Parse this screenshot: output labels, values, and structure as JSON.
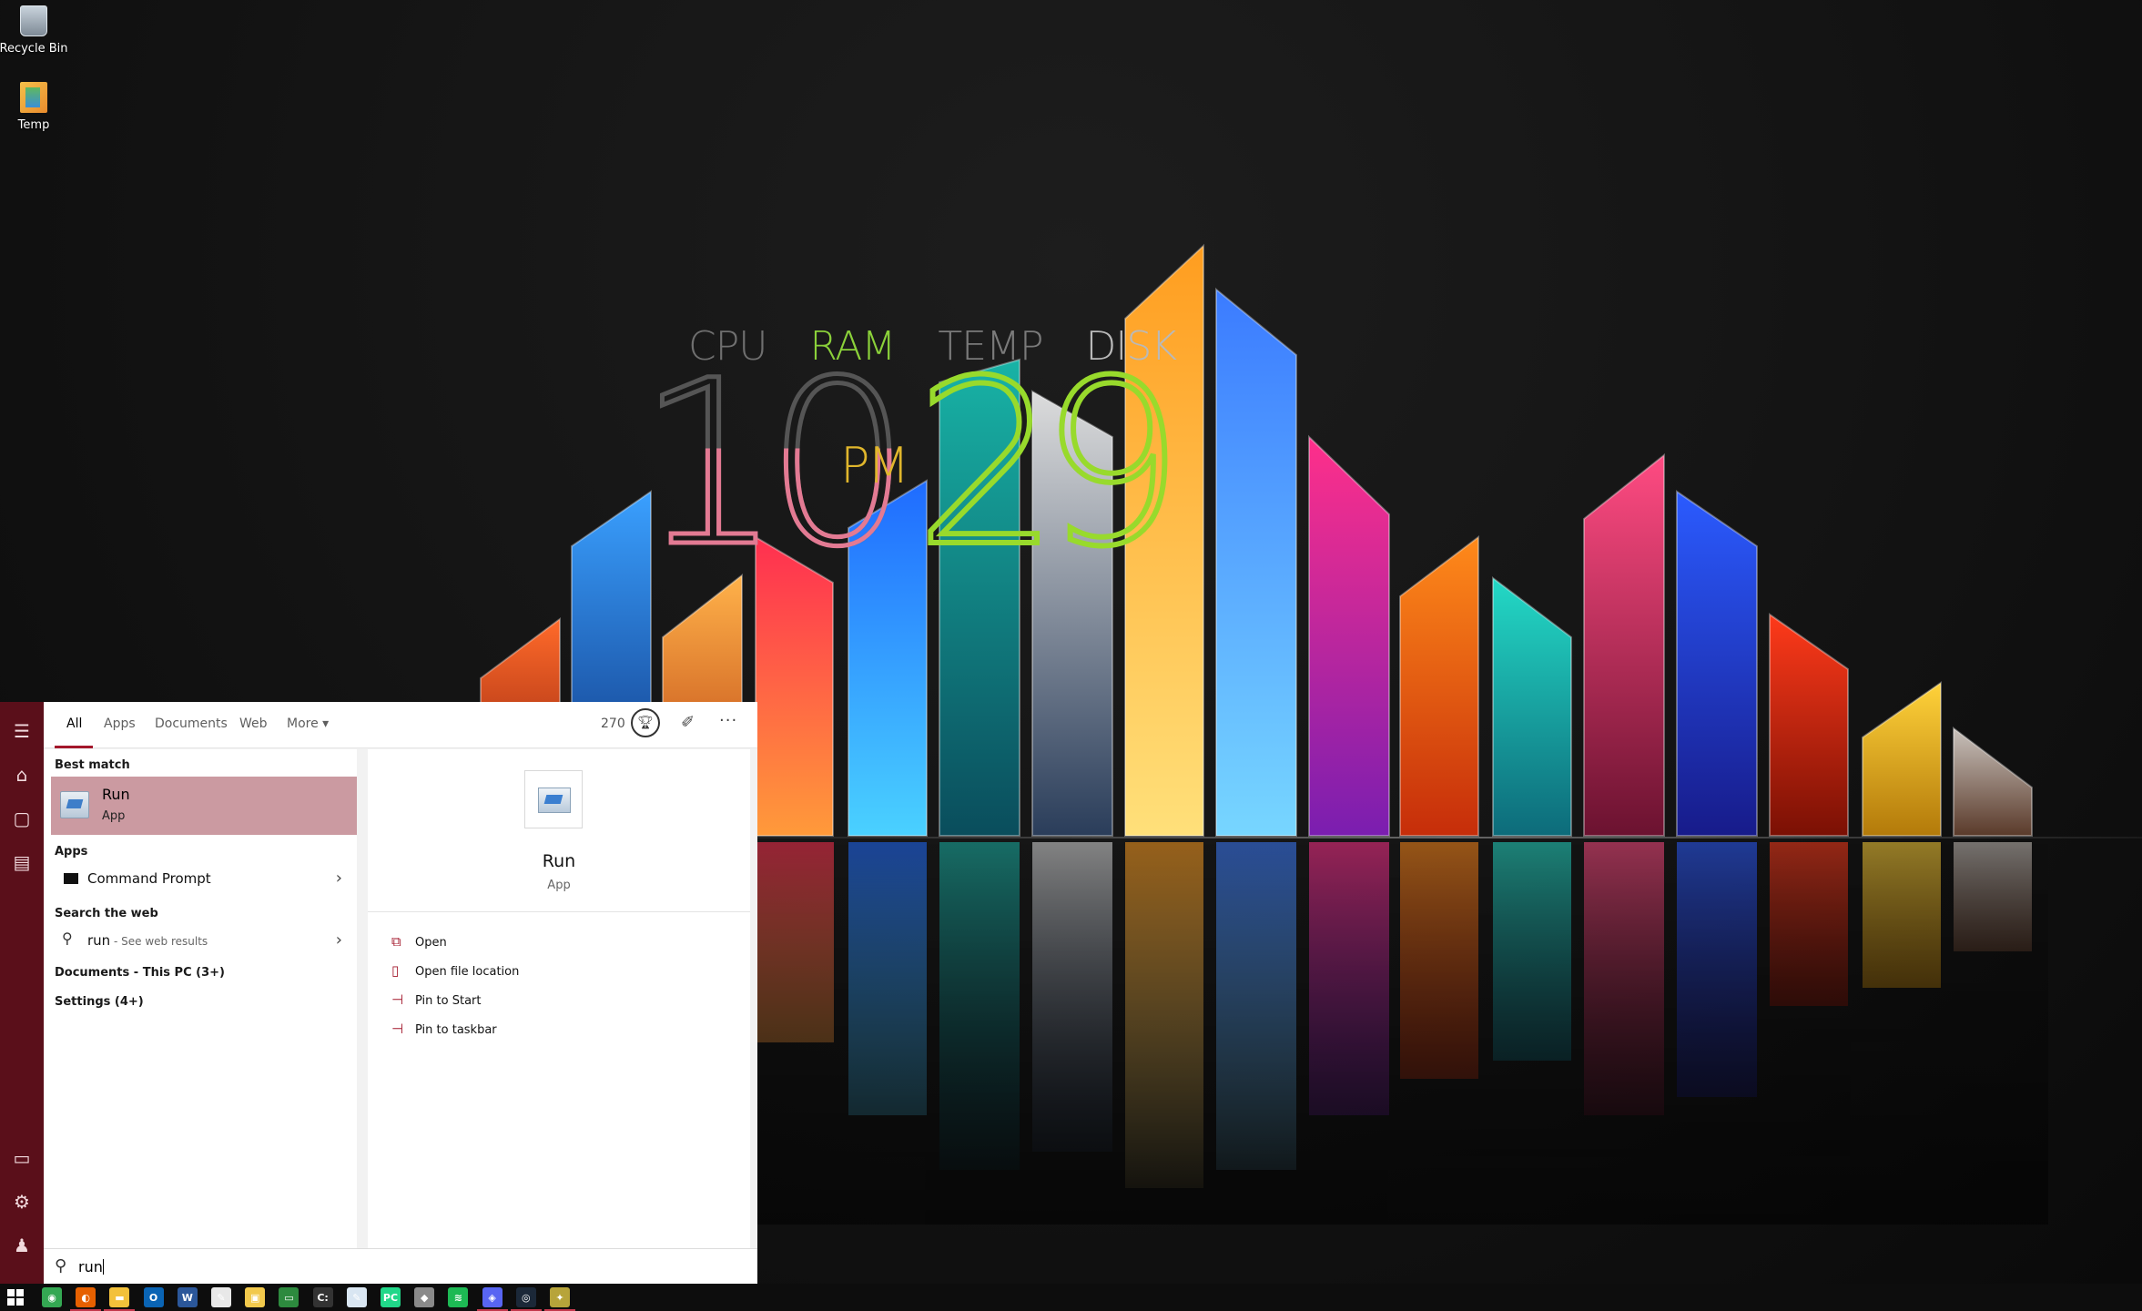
{
  "desktop": {
    "icons": [
      {
        "label": "Recycle Bin",
        "icon": "recycle-bin-icon"
      },
      {
        "label": "Temp",
        "icon": "folder-archive-icon"
      }
    ],
    "meters": {
      "cpu": "CPU",
      "ram": "RAM",
      "temp": "TEMP",
      "disk": "DISK"
    },
    "clock": {
      "hour": "10",
      "ampm": "PM",
      "minute": "29"
    }
  },
  "start_rail": {
    "items": [
      "hamburger-menu-icon",
      "home-icon",
      "notebook-icon",
      "document-icon",
      "device-icon",
      "gear-icon",
      "person-icon"
    ]
  },
  "search": {
    "tabs": [
      {
        "label": "All",
        "active": true
      },
      {
        "label": "Apps"
      },
      {
        "label": "Documents"
      },
      {
        "label": "Web"
      },
      {
        "label": "More"
      }
    ],
    "points": "270",
    "headers": {
      "best_match": "Best match",
      "apps": "Apps",
      "web": "Search the web"
    },
    "best_match": {
      "title": "Run",
      "subtitle": "App"
    },
    "apps": [
      {
        "label": "Command Prompt"
      }
    ],
    "web": {
      "query": "run",
      "suffix": " - See web results"
    },
    "more_links": [
      {
        "label": "Documents - This PC (3+)"
      },
      {
        "label": "Settings (4+)"
      }
    ],
    "details": {
      "title": "Run",
      "subtitle": "App",
      "actions": [
        {
          "label": "Open",
          "icon": "open-icon"
        },
        {
          "label": "Open file location",
          "icon": "file-location-icon"
        },
        {
          "label": "Pin to Start",
          "icon": "pin-icon"
        },
        {
          "label": "Pin to taskbar",
          "icon": "pin-icon"
        }
      ]
    },
    "input_value": "run"
  },
  "taskbar": {
    "apps": [
      {
        "name": "chrome-icon",
        "color": "#34a853",
        "glyph": "◉"
      },
      {
        "name": "firefox-icon",
        "color": "#e66000",
        "glyph": "◐",
        "running": true
      },
      {
        "name": "file-explorer-icon",
        "color": "#f3c13a",
        "glyph": "▬",
        "running": true
      },
      {
        "name": "outlook-icon",
        "color": "#0a64b4",
        "glyph": "O"
      },
      {
        "name": "word-icon",
        "color": "#2b579a",
        "glyph": "W"
      },
      {
        "name": "sticky-notes-icon",
        "color": "#e8e8e8",
        "glyph": "✎"
      },
      {
        "name": "photos-icon",
        "color": "#f2c94c",
        "glyph": "▣"
      },
      {
        "name": "terminal-icon",
        "color": "#2d8a3e",
        "glyph": "▭"
      },
      {
        "name": "command-prompt-icon",
        "color": "#333333",
        "glyph": "C:"
      },
      {
        "name": "notepad-icon",
        "color": "#d9e6f2",
        "glyph": "✎"
      },
      {
        "name": "pycharm-icon",
        "color": "#21d789",
        "glyph": "PC"
      },
      {
        "name": "discord-alt-icon",
        "color": "#8a8a8a",
        "glyph": "◆"
      },
      {
        "name": "spotify-icon",
        "color": "#1db954",
        "glyph": "≋"
      },
      {
        "name": "discord-icon",
        "color": "#5865f2",
        "glyph": "◈",
        "running": true
      },
      {
        "name": "steam-icon",
        "color": "#1b2838",
        "glyph": "◎",
        "running": true
      },
      {
        "name": "game-icon",
        "color": "#b7a43a",
        "glyph": "✦",
        "running": true
      }
    ]
  }
}
